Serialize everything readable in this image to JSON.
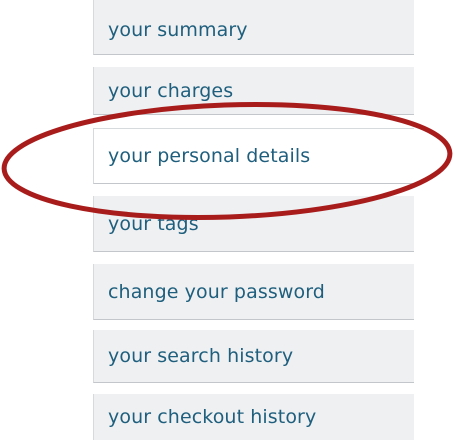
{
  "menu": {
    "items": [
      {
        "label": "your summary",
        "active": false
      },
      {
        "label": "your charges",
        "active": false
      },
      {
        "label": "your personal details",
        "active": true
      },
      {
        "label": "your tags",
        "active": false
      },
      {
        "label": "change your password",
        "active": false
      },
      {
        "label": "your search history",
        "active": false
      },
      {
        "label": "your checkout history",
        "active": false
      }
    ]
  },
  "annotation": {
    "shape": "ellipse",
    "color": "#a91c1c",
    "target": "your personal details"
  }
}
